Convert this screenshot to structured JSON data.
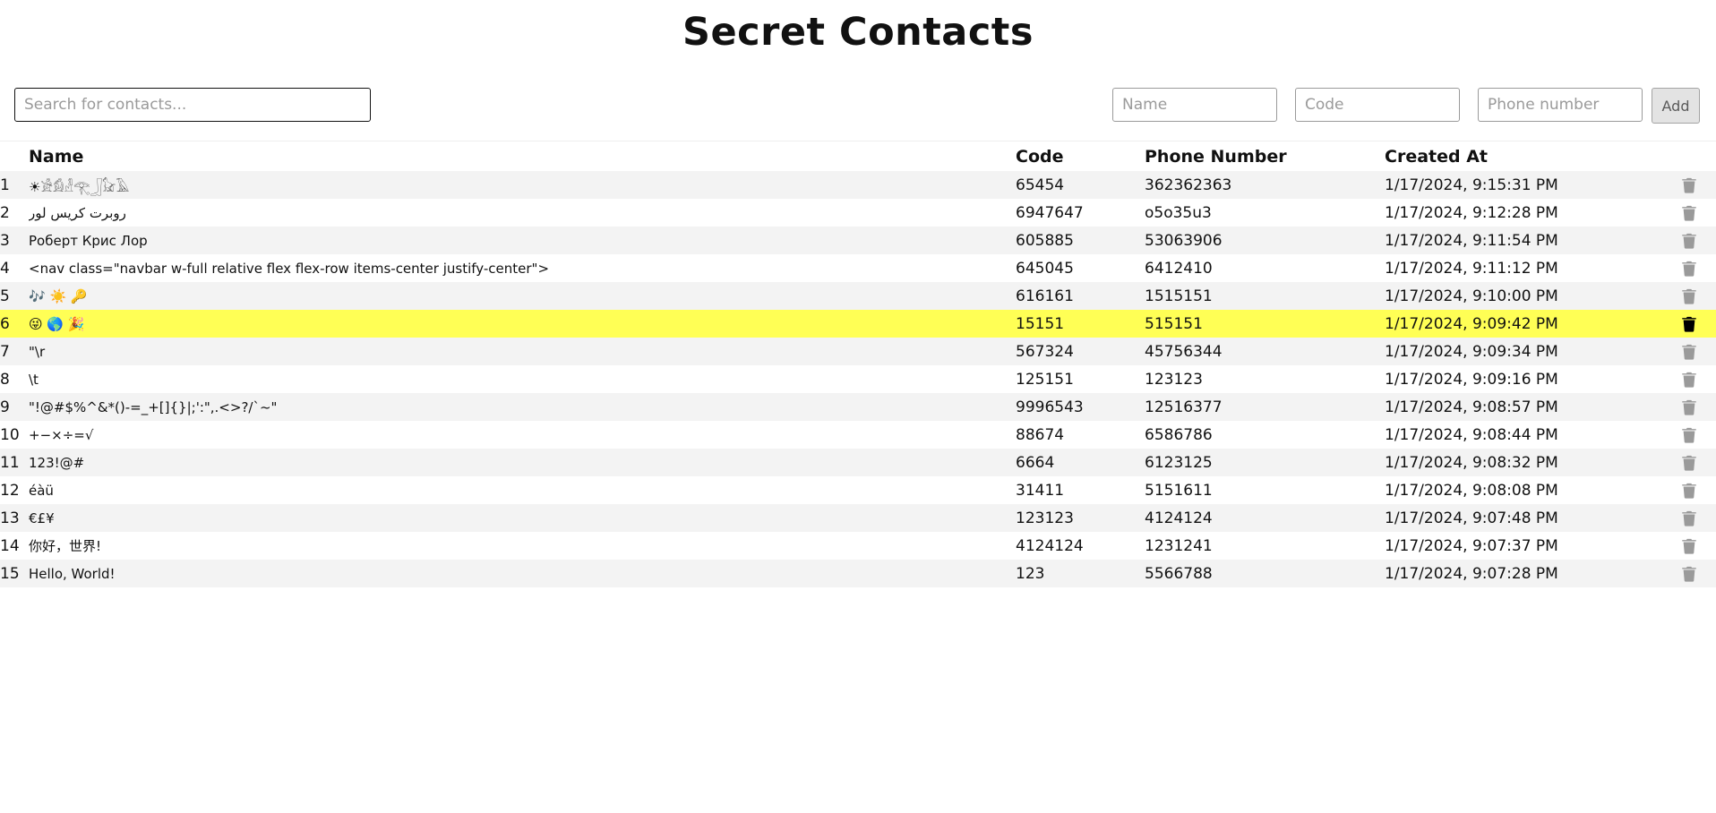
{
  "app": {
    "title": "Secret Contacts"
  },
  "search": {
    "placeholder": "Search for contacts...",
    "value": ""
  },
  "add_form": {
    "name_placeholder": "Name",
    "code_placeholder": "Code",
    "phone_placeholder": "Phone number",
    "add_label": "Add"
  },
  "table": {
    "headers": {
      "index": "",
      "name": "Name",
      "code": "Code",
      "phone": "Phone Number",
      "created": "Created At"
    },
    "rows": [
      {
        "index": "1",
        "name": "☀𓀀𓀁𓁐𓂀𓃀𓃠𓄿",
        "code": "65454",
        "phone": "362362363",
        "created": "1/17/2024, 9:15:31 PM"
      },
      {
        "index": "2",
        "name": "روبرت كريس لور",
        "code": "6947647",
        "phone": "o5o35u3",
        "created": "1/17/2024, 9:12:28 PM"
      },
      {
        "index": "3",
        "name": "Роберт Крис Лор",
        "code": "605885",
        "phone": "53063906",
        "created": "1/17/2024, 9:11:54 PM"
      },
      {
        "index": "4",
        "name": "<nav class=\"navbar w-full relative flex flex-row items-center justify-center\">",
        "code": "645045",
        "phone": "6412410",
        "created": "1/17/2024, 9:11:12 PM"
      },
      {
        "index": "5",
        "name": "🎶 ☀️ 🔑",
        "code": "616161",
        "phone": "1515151",
        "created": "1/17/2024, 9:10:00 PM"
      },
      {
        "index": "6",
        "name": "😜 🌎 🎉",
        "code": "15151",
        "phone": "515151",
        "created": "1/17/2024, 9:09:42 PM"
      },
      {
        "index": "7",
        "name": "\"\\r",
        "code": "567324",
        "phone": "45756344",
        "created": "1/17/2024, 9:09:34 PM"
      },
      {
        "index": "8",
        "name": "\\t",
        "code": "125151",
        "phone": "123123",
        "created": "1/17/2024, 9:09:16 PM"
      },
      {
        "index": "9",
        "name": "\"!@#$%^&*()-=_+[]{}|;':\",.<>?/`~\"",
        "code": "9996543",
        "phone": "12516377",
        "created": "1/17/2024, 9:08:57 PM"
      },
      {
        "index": "10",
        "name": "+−×÷=√",
        "code": "88674",
        "phone": "6586786",
        "created": "1/17/2024, 9:08:44 PM"
      },
      {
        "index": "11",
        "name": "123!@#",
        "code": "6664",
        "phone": "6123125",
        "created": "1/17/2024, 9:08:32 PM"
      },
      {
        "index": "12",
        "name": "éàü",
        "code": "31411",
        "phone": "5151611",
        "created": "1/17/2024, 9:08:08 PM"
      },
      {
        "index": "13",
        "name": "€£¥",
        "code": "123123",
        "phone": "4124124",
        "created": "1/17/2024, 9:07:48 PM"
      },
      {
        "index": "14",
        "name": "你好，世界!",
        "code": "4124124",
        "phone": "1231241",
        "created": "1/17/2024, 9:07:37 PM"
      },
      {
        "index": "15",
        "name": "Hello, World!",
        "code": "123",
        "phone": "5566788",
        "created": "1/17/2024, 9:07:28 PM"
      }
    ],
    "highlighted_row": 6,
    "row_icon": "trash-icon"
  },
  "colors": {
    "highlight": "#ffff55",
    "stripe": "#f3f3f3",
    "trash_default": "#9a9a9a",
    "trash_active": "#000000"
  }
}
